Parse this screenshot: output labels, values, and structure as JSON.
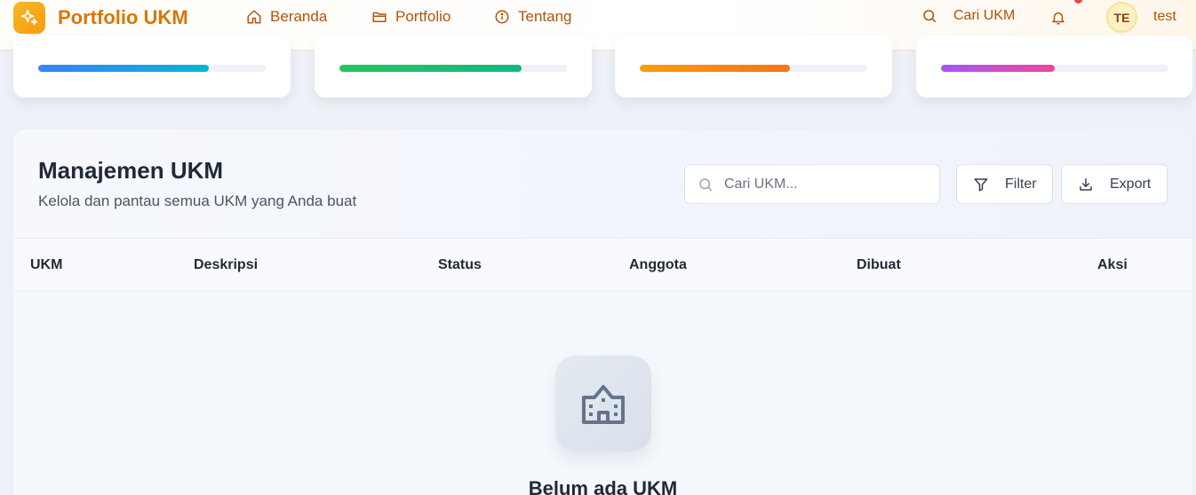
{
  "header": {
    "brand": "Portfolio UKM",
    "nav": [
      {
        "label": "Beranda",
        "icon": "home-icon"
      },
      {
        "label": "Portfolio",
        "icon": "folder-icon"
      },
      {
        "label": "Tentang",
        "icon": "info-icon"
      }
    ],
    "search_label": "Cari UKM",
    "avatar_initials": "TE",
    "username": "test"
  },
  "stat_cards": [
    {
      "progress": 0.75,
      "gradient": [
        "#3b82f6",
        "#06b6d4"
      ]
    },
    {
      "progress": 0.8,
      "gradient": [
        "#22c55e",
        "#10b981"
      ]
    },
    {
      "progress": 0.66,
      "gradient": [
        "#f59e0b",
        "#f97316"
      ]
    },
    {
      "progress": 0.5,
      "gradient": [
        "#a855f7",
        "#ec4899"
      ]
    }
  ],
  "panel": {
    "title": "Manajemen UKM",
    "subtitle": "Kelola dan pantau semua UKM yang Anda buat",
    "search_placeholder": "Cari UKM...",
    "filter_label": "Filter",
    "export_label": "Export",
    "columns": [
      "UKM",
      "Deskripsi",
      "Status",
      "Anggota",
      "Dibuat",
      "Aksi"
    ],
    "empty_title": "Belum ada UKM"
  },
  "colors": {
    "accent": "#d97706",
    "nav_text": "#b45309"
  }
}
